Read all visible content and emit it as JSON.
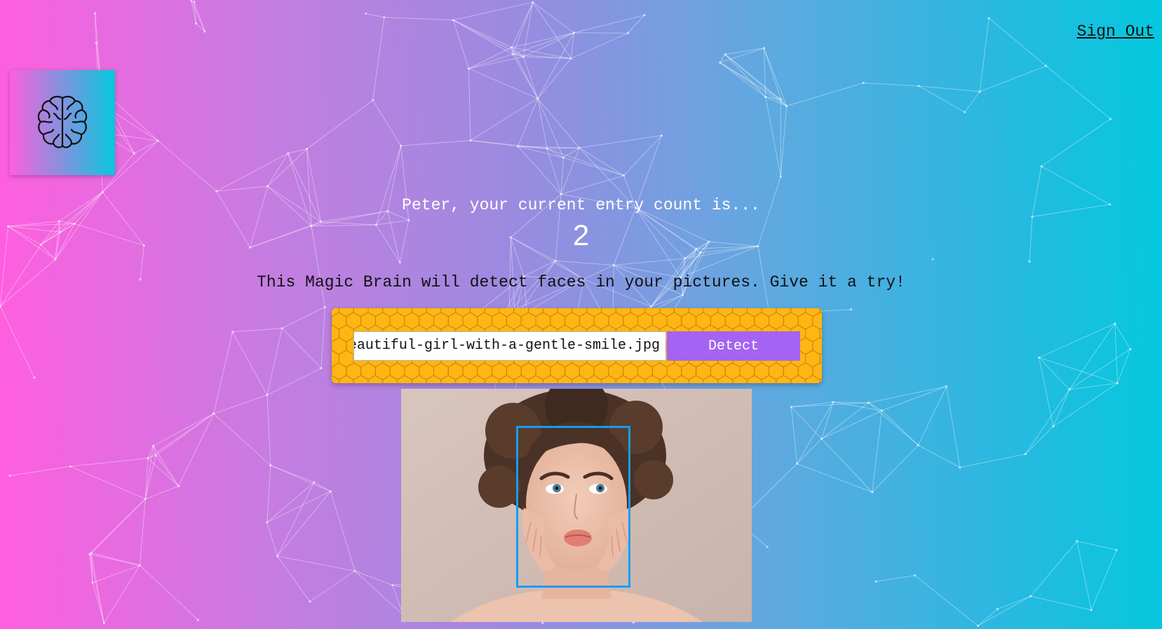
{
  "header": {
    "signout_label": "Sign Out"
  },
  "logo": {
    "icon": "brain-icon"
  },
  "rank": {
    "message": "Peter, your current entry count is...",
    "count": "2"
  },
  "tagline": "This Magic Brain will detect faces in your pictures. Give it a try!",
  "form": {
    "url_value": "beautiful-girl-with-a-gentle-smile.jpg",
    "detect_label": "Detect"
  },
  "result_image": {
    "subject": "face-photo",
    "face_boxes": 1
  },
  "colors": {
    "gradient_start": "#ff5edf",
    "gradient_end": "#04c8de",
    "form_bg": "#ffb613",
    "button_bg": "#a463f2",
    "face_box": "#149df2"
  }
}
